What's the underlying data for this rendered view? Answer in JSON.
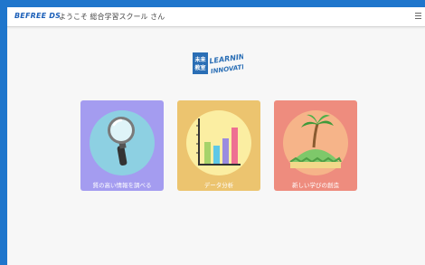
{
  "header": {
    "brand": "BEFREE DS",
    "welcome": "ようこそ 総合学習スクール さん"
  },
  "logo": {
    "line1": "LEARNING",
    "line2": "INNOVATION",
    "badge_top": "未来",
    "badge_bottom": "教室"
  },
  "cards": [
    {
      "label": "質の高い情報を調べる",
      "color": "#a49cf0",
      "circle": "#8dd0e2"
    },
    {
      "label": "データ分析",
      "color": "#ecc46f",
      "circle": "#fbeea2"
    },
    {
      "label": "新しい学びの創造",
      "color": "#ee8c7e",
      "circle": "#f6b489"
    }
  ],
  "colors": {
    "frame": "#1f76cc",
    "background": "#f7f7f7"
  }
}
